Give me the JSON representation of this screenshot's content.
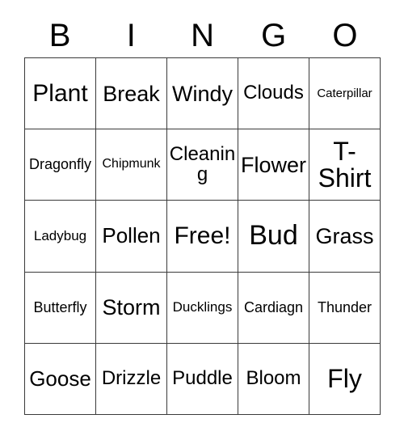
{
  "card": {
    "type": "bingo-card",
    "header_letters": [
      "B",
      "I",
      "N",
      "G",
      "O"
    ],
    "rows": 5,
    "columns": 5,
    "colors": {
      "background": "#ffffff",
      "text": "#000000",
      "grid_line": "#3a3a3a"
    },
    "cells": [
      [
        {
          "label": "Plant",
          "size": "fs-4xl"
        },
        {
          "label": "Break",
          "size": "fs-xxl"
        },
        {
          "label": "Windy",
          "size": "fs-xxl"
        },
        {
          "label": "Clouds",
          "size": "fs-l"
        },
        {
          "label": "Caterpillar",
          "size": "fs-xs"
        }
      ],
      [
        {
          "label": "Dragonfly",
          "size": "fs-m"
        },
        {
          "label": "Chipmunk",
          "size": "fs-s"
        },
        {
          "label": "Cleaning",
          "size": "fs-l"
        },
        {
          "label": "Flower",
          "size": "fs-xxl"
        },
        {
          "label": "T-Shirt",
          "size": "fs-5xl"
        }
      ],
      [
        {
          "label": "Ladybug",
          "size": "fs-sm"
        },
        {
          "label": "Pollen",
          "size": "fs-xl"
        },
        {
          "label": "Free!",
          "size": "fs-4xl"
        },
        {
          "label": "Bud",
          "size": "fs-6xl"
        },
        {
          "label": "Grass",
          "size": "fs-xxl"
        }
      ],
      [
        {
          "label": "Butterfly",
          "size": "fs-m"
        },
        {
          "label": "Storm",
          "size": "fs-xxl"
        },
        {
          "label": "Ducklings",
          "size": "fs-sm"
        },
        {
          "label": "Cardiagn",
          "size": "fs-m"
        },
        {
          "label": "Thunder",
          "size": "fs-m"
        }
      ],
      [
        {
          "label": "Goose",
          "size": "fs-xl"
        },
        {
          "label": "Drizzle",
          "size": "fs-l"
        },
        {
          "label": "Puddle",
          "size": "fs-l"
        },
        {
          "label": "Bloom",
          "size": "fs-l"
        },
        {
          "label": "Fly",
          "size": "fs-5xl"
        }
      ]
    ]
  }
}
